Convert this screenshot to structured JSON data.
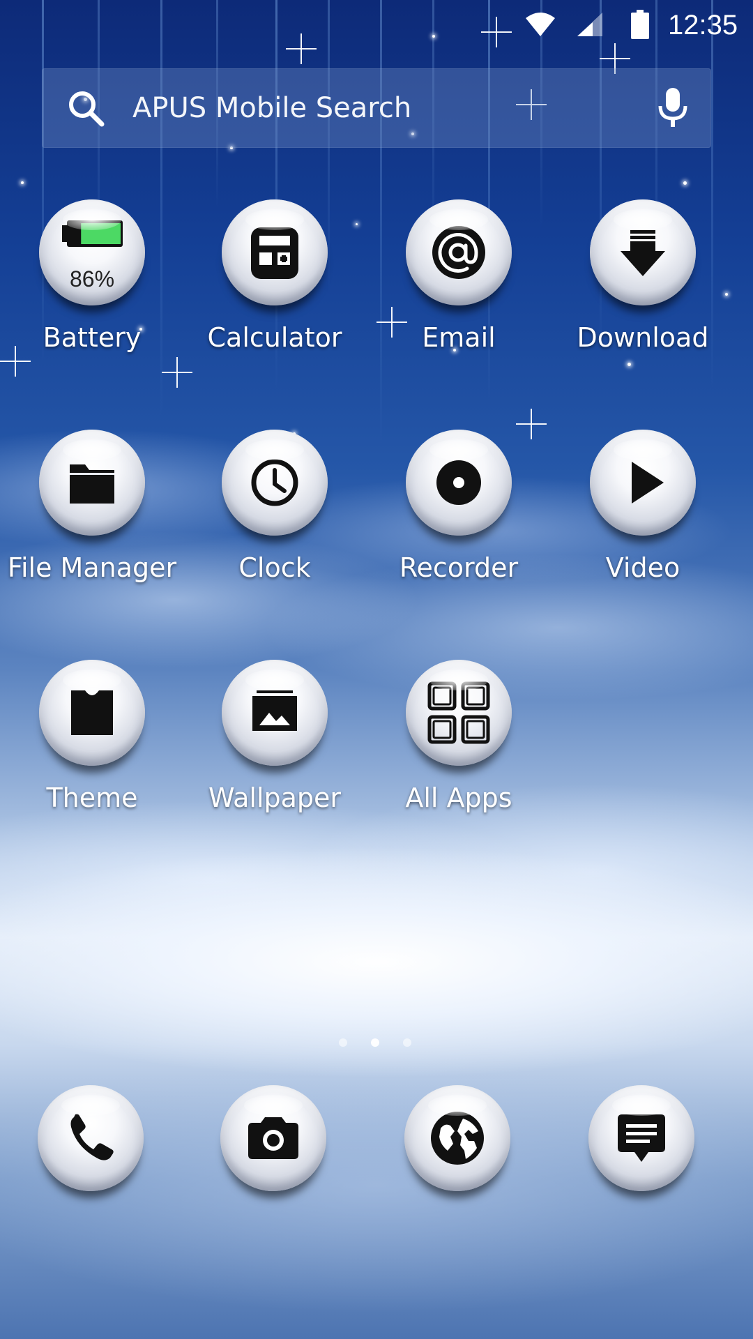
{
  "status_bar": {
    "time": "12:35",
    "icons": [
      "wifi-icon",
      "cell-signal-icon",
      "battery-status-icon"
    ]
  },
  "search": {
    "placeholder": "APUS Mobile Search",
    "left_icon": "search-icon",
    "right_icon": "mic-icon"
  },
  "apps": [
    {
      "label": "Battery",
      "icon": "battery-icon",
      "badge": "86%",
      "level": 0.86,
      "accent": "#4cd964"
    },
    {
      "label": "Calculator",
      "icon": "calculator-icon"
    },
    {
      "label": "Email",
      "icon": "at-sign-icon"
    },
    {
      "label": "Download",
      "icon": "download-arrow-icon"
    },
    {
      "label": "File Manager",
      "icon": "folder-icon"
    },
    {
      "label": "Clock",
      "icon": "clock-icon"
    },
    {
      "label": "Recorder",
      "icon": "record-icon"
    },
    {
      "label": "Video",
      "icon": "play-icon"
    },
    {
      "label": "Theme",
      "icon": "shirt-icon"
    },
    {
      "label": "Wallpaper",
      "icon": "image-stack-icon"
    },
    {
      "label": "All Apps",
      "icon": "grid-apps-icon"
    }
  ],
  "page_indicator": {
    "count": 3,
    "active": 1
  },
  "dock": [
    {
      "icon": "phone-icon"
    },
    {
      "icon": "camera-icon"
    },
    {
      "icon": "globe-icon"
    },
    {
      "icon": "message-icon"
    }
  ]
}
